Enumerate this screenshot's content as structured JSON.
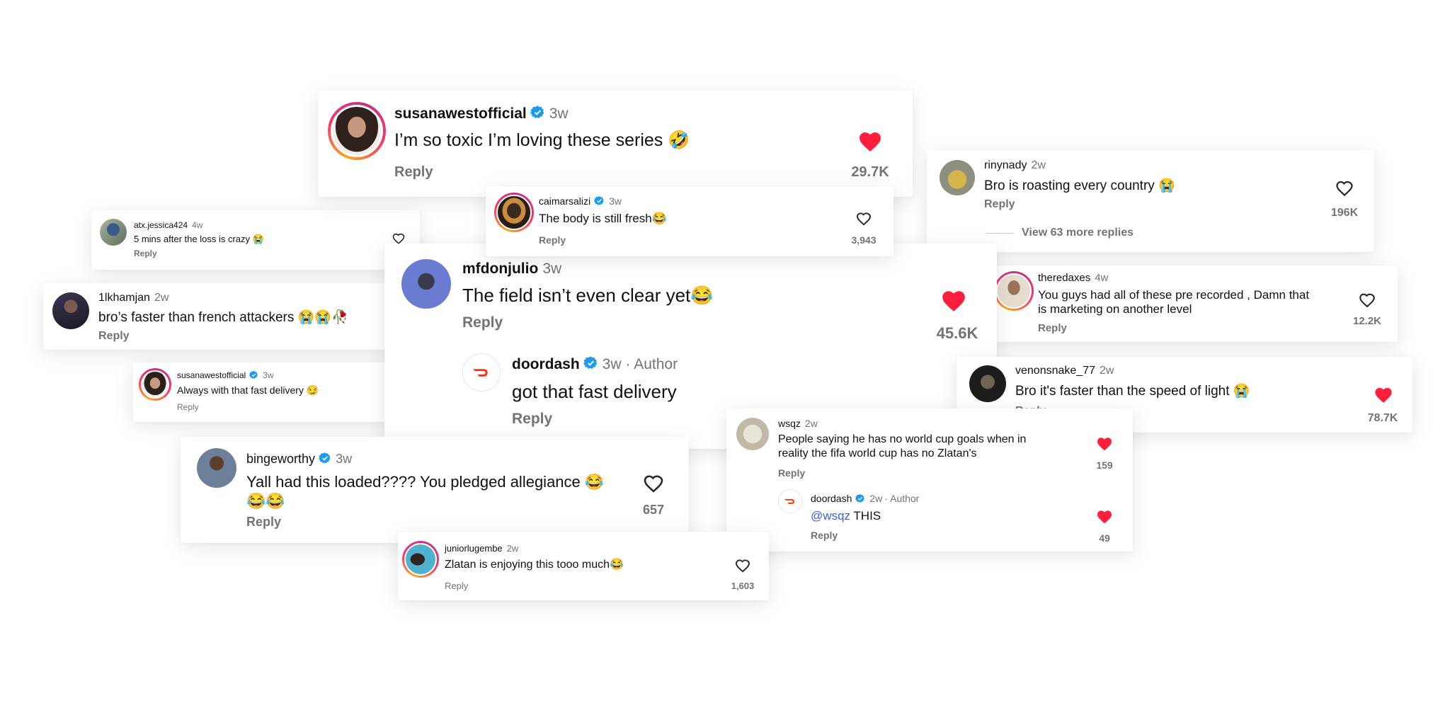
{
  "colors": {
    "heart_red": "#ff1f3d",
    "verified_blue": "#1d9bf0",
    "doordash_red": "#ff3008",
    "muted": "#737373"
  },
  "comments": {
    "susana_main": {
      "username": "susanawestofficial",
      "time": "3w",
      "text": "I’m so toxic I’m loving these series 🤣",
      "reply": "Reply",
      "likes": "29.7K",
      "liked": true,
      "verified": true
    },
    "atx": {
      "username": "atx.jessica424",
      "time": "4w",
      "text": "5 mins after the loss is crazy 😭",
      "reply": "Reply"
    },
    "caimar": {
      "username": "caimarsalizi",
      "time": "3w",
      "text": "The body is still fresh😂",
      "reply": "Reply",
      "likes": "3,943",
      "verified": true
    },
    "rinynady": {
      "username": "rinynady",
      "time": "2w",
      "text": "Bro is roasting every country 😭",
      "reply": "Reply",
      "likes": "196K",
      "view_more": "View 63 more replies"
    },
    "ilkhamjan": {
      "username": "1lkhamjan",
      "time": "2w",
      "text": "bro’s faster than french attackers 😭😭🥀",
      "reply": "Reply"
    },
    "mfdonjulio": {
      "username": "mfdonjulio",
      "time": "3w",
      "text": "The field isn’t even clear yet😂",
      "reply": "Reply",
      "likes": "45.6K",
      "liked": true
    },
    "doordash_reply1": {
      "username": "doordash",
      "time": "3w",
      "author_tag": "· Author",
      "text": "got that fast delivery",
      "reply": "Reply",
      "verified": true
    },
    "theredaxes": {
      "username": "theredaxes",
      "time": "4w",
      "text_line1": "You guys had all of these pre recorded , Damn that",
      "text_line2": "is marketing on another level",
      "reply": "Reply",
      "likes": "12.2K"
    },
    "susana_small": {
      "username": "susanawestofficial",
      "time": "3w",
      "text": "Always with that fast delivery 😏",
      "reply": "Reply",
      "verified": true
    },
    "venonsnake": {
      "username": "venonsnake_77",
      "time": "2w",
      "text": "Bro it's faster than the speed of light 😭",
      "reply": "Reply",
      "likes": "78.7K",
      "liked": true
    },
    "wsqz": {
      "username": "wsqz",
      "time": "2w",
      "text_line1": "People saying he has no world cup goals when in",
      "text_line2": "reality the fifa world cup has no Zlatan's",
      "reply": "Reply",
      "likes": "159",
      "liked": true
    },
    "doordash_reply2": {
      "username": "doordash",
      "time": "2w",
      "author_tag": "· Author",
      "mention": "@wsqz",
      "text": " THIS",
      "reply": "Reply",
      "likes": "49",
      "liked": true,
      "verified": true
    },
    "bingeworthy": {
      "username": "bingeworthy",
      "time": "3w",
      "text_line1": "Yall had this loaded???? You pledged allegiance 😂",
      "text_line2": "😂😂",
      "reply": "Reply",
      "likes": "657",
      "verified": true
    },
    "juniorlugembe": {
      "username": "juniorlugembe",
      "time": "2w",
      "text": "Zlatan is enjoying this tooo much😂",
      "reply": "Reply",
      "likes": "1,603"
    }
  }
}
